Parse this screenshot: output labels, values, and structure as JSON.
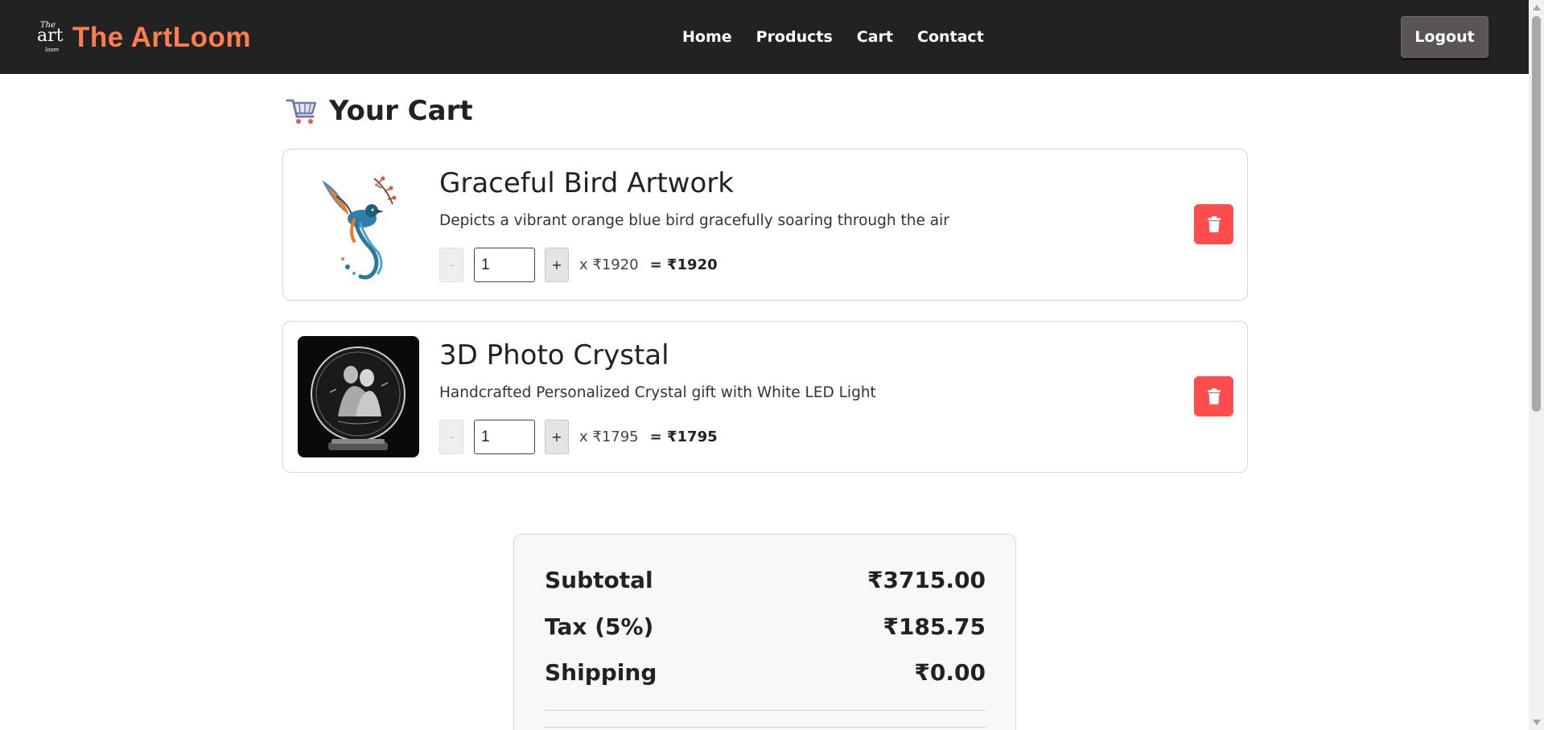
{
  "header": {
    "logo_text": [
      "The",
      "art",
      "loom"
    ],
    "brand": "The ArtLoom",
    "nav": [
      "Home",
      "Products",
      "Cart",
      "Contact"
    ],
    "logout_label": "Logout"
  },
  "page": {
    "title": "Your Cart",
    "title_icon": "shopping-cart-icon"
  },
  "cart": {
    "items": [
      {
        "title": "Graceful Bird Artwork",
        "description": "Depicts a vibrant orange blue bird gracefully soaring through the air",
        "qty": "1",
        "unit_price": "x ₹1920",
        "line_total": "= ₹1920",
        "minus": "-",
        "plus": "+",
        "image": "bird-artwork-image"
      },
      {
        "title": "3D Photo Crystal",
        "description": "Handcrafted Personalized Crystal gift with White LED Light",
        "qty": "1",
        "unit_price": "x ₹1795",
        "line_total": "= ₹1795",
        "minus": "-",
        "plus": "+",
        "image": "photo-crystal-image"
      }
    ]
  },
  "summary": {
    "subtotal_label": "Subtotal",
    "subtotal_value": "₹3715.00",
    "tax_label": "Tax (5%)",
    "tax_value": "₹185.75",
    "shipping_label": "Shipping",
    "shipping_value": "₹0.00"
  },
  "colors": {
    "navbar": "#222222",
    "brand": "#ff7e4d",
    "delete": "#ff4d4d",
    "logout": "#5a5554"
  }
}
